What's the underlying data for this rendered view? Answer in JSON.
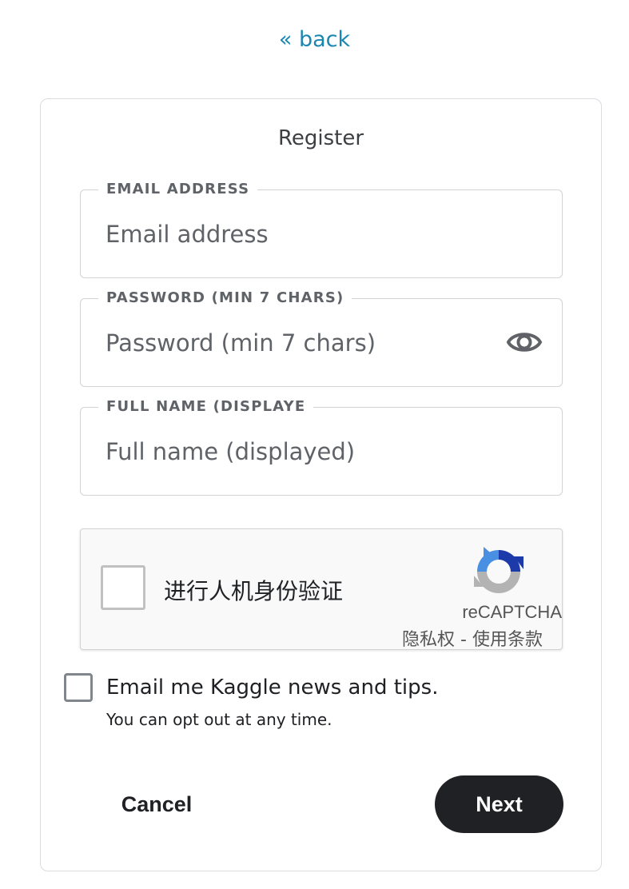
{
  "nav": {
    "back_label": "« back"
  },
  "form": {
    "title": "Register",
    "fields": [
      {
        "label": "EMAIL ADDRESS",
        "placeholder": "Email address",
        "value": ""
      },
      {
        "label": "PASSWORD (MIN 7 CHARS)",
        "placeholder": "Password (min 7 chars)",
        "value": "",
        "icon": "eye-icon"
      },
      {
        "label": "FULL NAME (DISPLAYE",
        "placeholder": "Full name (displayed)",
        "value": ""
      }
    ]
  },
  "recaptcha": {
    "label": "进行人机身份验证",
    "brand": "reCAPTCHA",
    "privacy": "隐私权",
    "separator": " - ",
    "terms": "使用条款",
    "icon": "recaptcha-logo-icon",
    "colors": {
      "blue": "#1c3aa9",
      "light_blue": "#4a90e2",
      "gray": "#b3b3b3"
    }
  },
  "optin": {
    "label": "Email me Kaggle news and tips.",
    "sublabel": "You can opt out at any time.",
    "checked": false
  },
  "actions": {
    "cancel_label": "Cancel",
    "next_label": "Next"
  },
  "colors": {
    "accent_link": "#1b87b0",
    "primary_button": "#202124",
    "border": "#dadce0"
  }
}
